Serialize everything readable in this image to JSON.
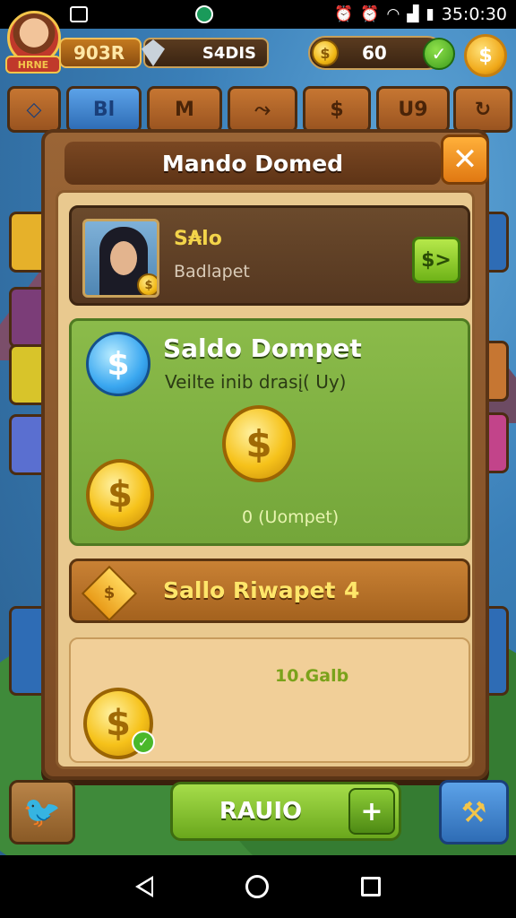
{
  "status_bar": {
    "time": "35:0:30",
    "icons": [
      "gallery-icon",
      "app-icon",
      "alarm-icon",
      "alarm2-icon",
      "wifi-icon",
      "signal-icon",
      "battery-icon"
    ]
  },
  "hud": {
    "avatar_badge": "HRNE",
    "level": "903R",
    "gems": "S4DIS",
    "coins": "60",
    "coin_symbol": "$",
    "gold_button_symbol": "$"
  },
  "tabs": [
    {
      "label": "Bl",
      "style": "blue"
    },
    {
      "label": "M",
      "style": "brown"
    },
    {
      "label": "⤳",
      "style": "brown"
    },
    {
      "label": "$",
      "style": "brown"
    },
    {
      "label": "U9",
      "style": "brown"
    },
    {
      "label": "↻",
      "style": "brown"
    }
  ],
  "dialog": {
    "title": "Mando Domed",
    "close_symbol": "✕",
    "profile": {
      "name": "S₳lo",
      "subtitle": "Badlapet",
      "action_symbol": "$>"
    },
    "wallet": {
      "title": "Saldo Dompet",
      "subtitle": "Veilte inib drasį( Uy)",
      "note": "0 (Uompet)",
      "coin_symbol": "$"
    },
    "reward": {
      "label": "Sallo Riwapet",
      "count": "4",
      "diamond_symbol": "$"
    },
    "balance": {
      "value": "10.Galb",
      "check_symbol": "✓"
    }
  },
  "bottom": {
    "main_button": "RAUIO",
    "plus_symbol": "+",
    "tool_symbol": "⚒"
  },
  "colors": {
    "accent_green": "#8bbb4a",
    "panel_brown": "#7b4a23",
    "gold": "#f6c21a",
    "title_yellow": "#ffe66a"
  }
}
